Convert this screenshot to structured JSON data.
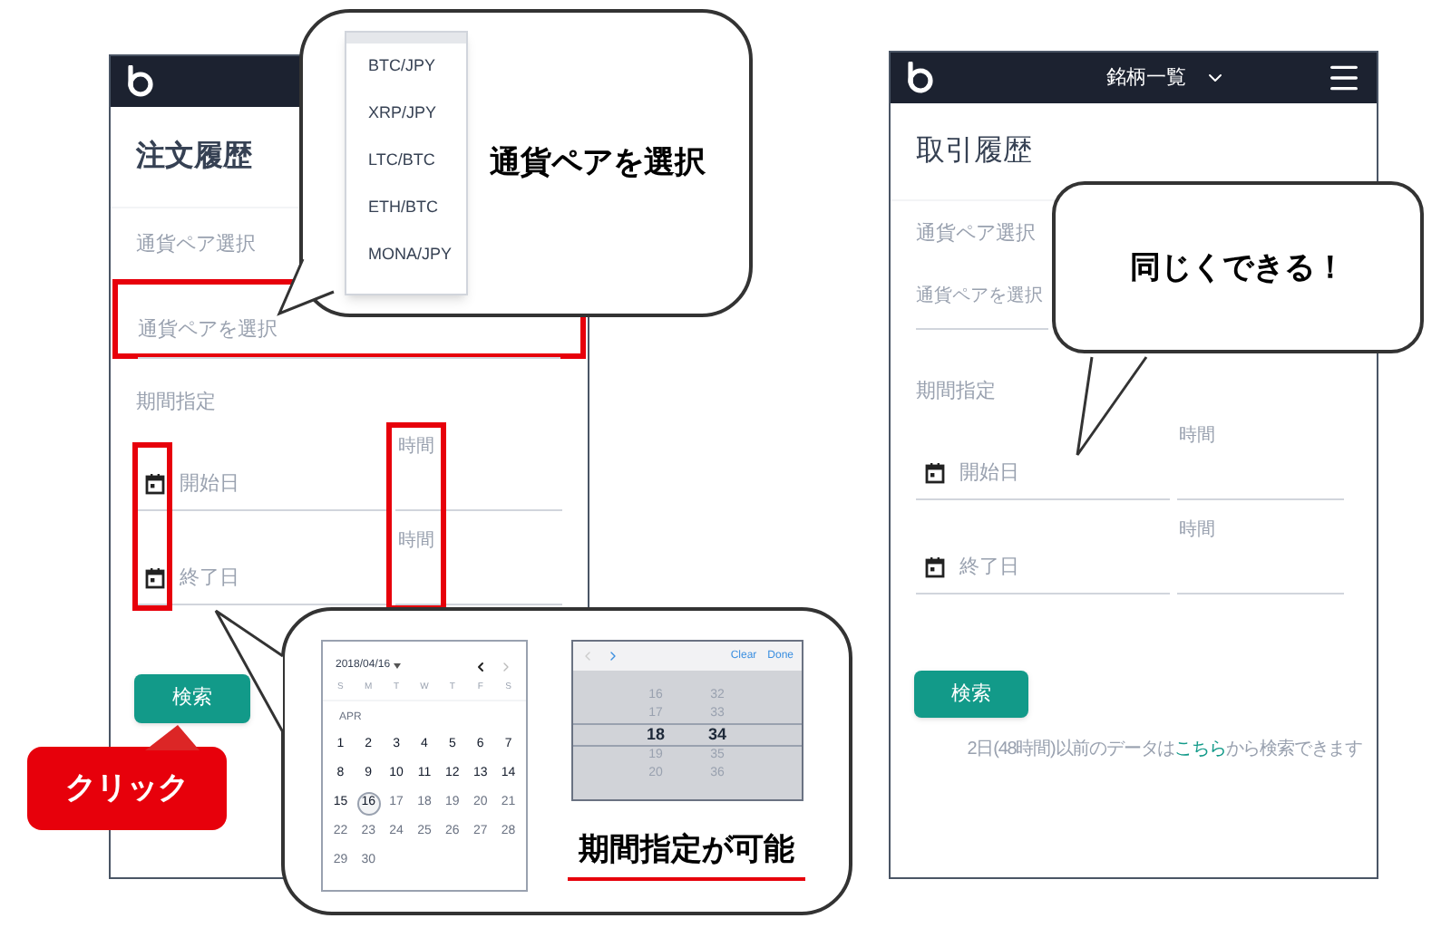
{
  "left_screen": {
    "title": "注文履歴",
    "pair_label": "通貨ペア選択",
    "pair_field": {
      "placeholder": "通貨ペアを選択",
      "highlighted": true
    },
    "period_label": "期間指定",
    "icons_highlighted": true,
    "times_highlighted": true,
    "date_rows": [
      {
        "placeholder": "開始日",
        "time_label": "時間"
      },
      {
        "placeholder": "終了日",
        "time_label": "時間"
      }
    ],
    "search_button": "検索"
  },
  "click_badge": "クリック",
  "pair_callout": {
    "options": [
      "BTC/JPY",
      "XRP/JPY",
      "LTC/BTC",
      "ETH/BTC",
      "MONA/JPY"
    ],
    "caption": "通貨ペアを選択"
  },
  "period_callout": {
    "calendar": {
      "date": "2018/04/16",
      "weekdays": [
        "S",
        "M",
        "T",
        "W",
        "T",
        "F",
        "S"
      ],
      "month": "APR",
      "days": [
        {
          "label": "1",
          "selected": false,
          "disabled": false
        },
        {
          "label": "2",
          "selected": false,
          "disabled": false
        },
        {
          "label": "3",
          "selected": false,
          "disabled": false
        },
        {
          "label": "4",
          "selected": false,
          "disabled": false
        },
        {
          "label": "5",
          "selected": false,
          "disabled": false
        },
        {
          "label": "6",
          "selected": false,
          "disabled": false
        },
        {
          "label": "7",
          "selected": false,
          "disabled": false
        },
        {
          "label": "8",
          "selected": false,
          "disabled": false
        },
        {
          "label": "9",
          "selected": false,
          "disabled": false
        },
        {
          "label": "10",
          "selected": false,
          "disabled": false
        },
        {
          "label": "11",
          "selected": false,
          "disabled": false
        },
        {
          "label": "12",
          "selected": false,
          "disabled": false
        },
        {
          "label": "13",
          "selected": false,
          "disabled": false
        },
        {
          "label": "14",
          "selected": false,
          "disabled": false
        },
        {
          "label": "15",
          "selected": false,
          "disabled": false
        },
        {
          "label": "16",
          "selected": true,
          "disabled": false
        },
        {
          "label": "17",
          "selected": false,
          "disabled": true
        },
        {
          "label": "18",
          "selected": false,
          "disabled": true
        },
        {
          "label": "19",
          "selected": false,
          "disabled": true
        },
        {
          "label": "20",
          "selected": false,
          "disabled": true
        },
        {
          "label": "21",
          "selected": false,
          "disabled": true
        },
        {
          "label": "22",
          "selected": false,
          "disabled": true
        },
        {
          "label": "23",
          "selected": false,
          "disabled": true
        },
        {
          "label": "24",
          "selected": false,
          "disabled": true
        },
        {
          "label": "25",
          "selected": false,
          "disabled": true
        },
        {
          "label": "26",
          "selected": false,
          "disabled": true
        },
        {
          "label": "27",
          "selected": false,
          "disabled": true
        },
        {
          "label": "28",
          "selected": false,
          "disabled": true
        },
        {
          "label": "29",
          "selected": false,
          "disabled": true
        },
        {
          "label": "30",
          "selected": false,
          "disabled": true
        }
      ]
    },
    "picker": {
      "buttons": [
        "Clear",
        "Done"
      ],
      "rows": [
        {
          "hour": "16",
          "minute": "32",
          "selected": false
        },
        {
          "hour": "17",
          "minute": "33",
          "selected": false
        },
        {
          "hour": "18",
          "minute": "34",
          "selected": true
        },
        {
          "hour": "19",
          "minute": "35",
          "selected": false
        },
        {
          "hour": "20",
          "minute": "36",
          "selected": false
        }
      ]
    },
    "caption": "期間指定が可能"
  },
  "right_screen": {
    "header_title": "銘柄一覧",
    "title": "取引履歴",
    "pair_label": "通貨ペア選択",
    "pair_field": {
      "label": "通貨ペアを選択"
    },
    "period_label": "期間指定",
    "date_rows": [
      {
        "placeholder": "開始日",
        "time_label": "時間"
      },
      {
        "placeholder": "終了日",
        "time_label": "時間"
      }
    ],
    "search_button": "検索",
    "note": {
      "before": "2日(48時間)以前のデータは",
      "link": "こちら",
      "after": "から検索できます"
    }
  },
  "same_callout": {
    "caption": "同じくできる！"
  }
}
